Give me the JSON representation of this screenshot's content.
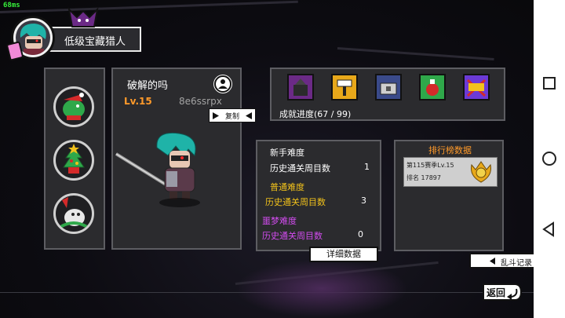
{
  "debug": {
    "fps": "68ms"
  },
  "header": {
    "title": "低级宝藏猎人"
  },
  "hero": {
    "name": "破解的吗",
    "level": "Lv.15",
    "player_id": "8e6ssrpx",
    "copy_label": "复制"
  },
  "pets": [
    {
      "icon": "crocodile-santa-icon"
    },
    {
      "icon": "christmas-tree-icon"
    },
    {
      "icon": "snowman-wolf-icon"
    }
  ],
  "achievements": {
    "icons": [
      "castle-icon",
      "hammer-icon",
      "chest-icon",
      "potion-icon",
      "hundred-badge-icon"
    ],
    "progress": "成就进度(67 / 99)"
  },
  "difficulty": {
    "easy": {
      "title": "新手难度",
      "label": "历史通关周目数",
      "value": "1",
      "color": "#ffffff"
    },
    "normal": {
      "title": "普通难度",
      "label": "历史通关周目数",
      "value": "3",
      "color": "#f2c21b"
    },
    "nightmare": {
      "title": "噩梦难度",
      "label": "历史通关周目数",
      "value": "0",
      "color": "#d34cf0"
    }
  },
  "detail_button": "详细数据",
  "rank": {
    "title": "排行榜数据",
    "season": "第115赛季Lv.15",
    "position": "排名 17897"
  },
  "brawl_button": "乱斗记录",
  "back_button": "返回"
}
